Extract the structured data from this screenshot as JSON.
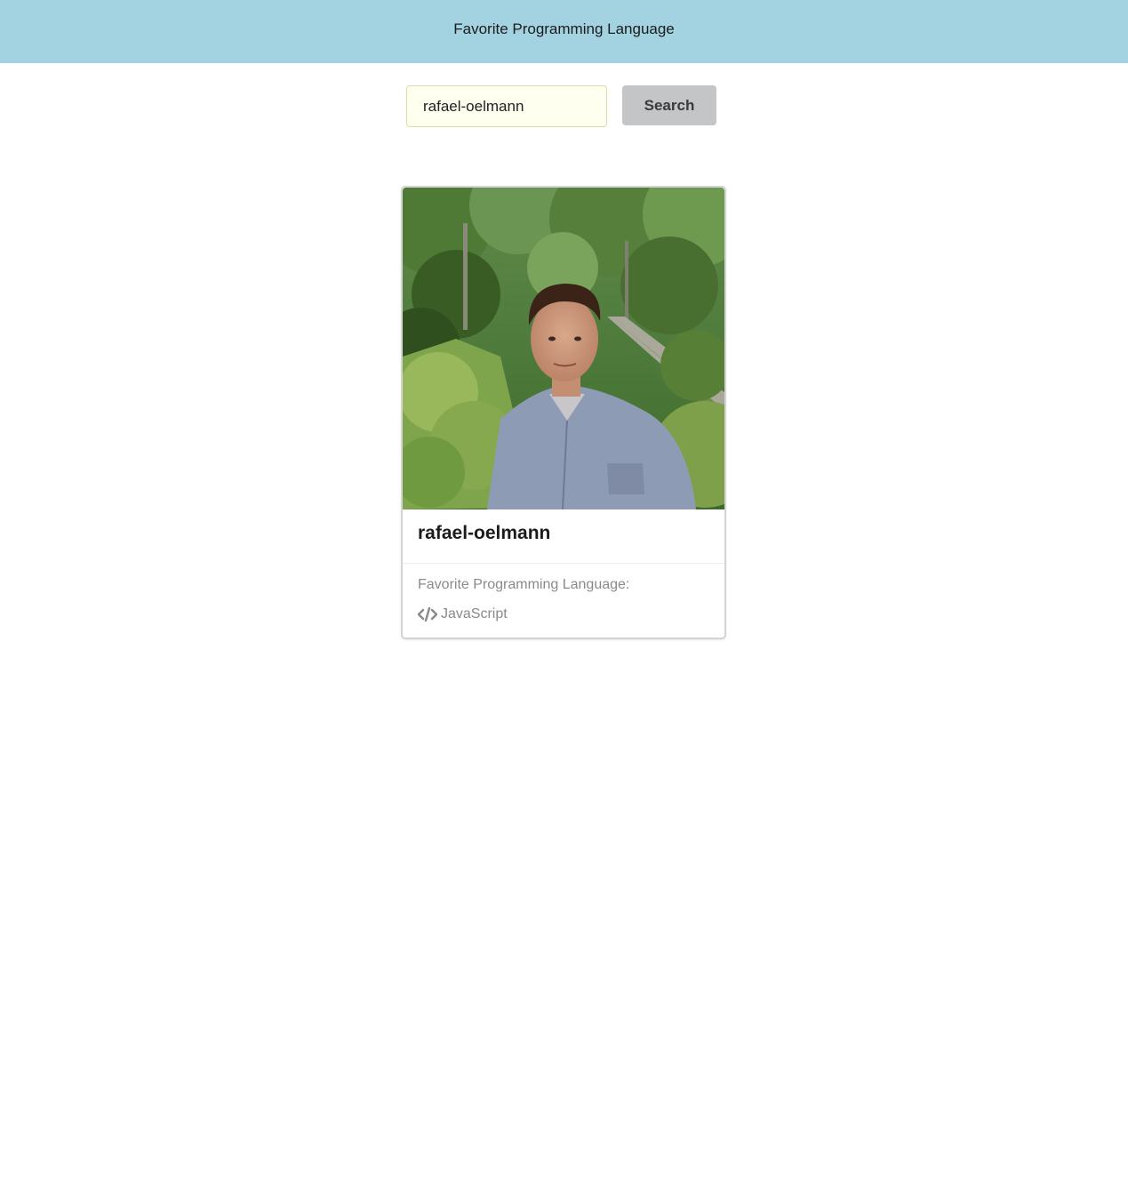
{
  "header": {
    "title": "Favorite Programming Language"
  },
  "search": {
    "value": "rafael-oelmann",
    "button_label": "Search"
  },
  "card": {
    "username": "rafael-oelmann",
    "meta_label": "Favorite Programming Language:",
    "language": "JavaScript",
    "language_icon": "code-icon"
  },
  "colors": {
    "header_bg": "#a3d2e0",
    "input_bg": "#ffffef",
    "button_bg": "#c4c5c7"
  }
}
